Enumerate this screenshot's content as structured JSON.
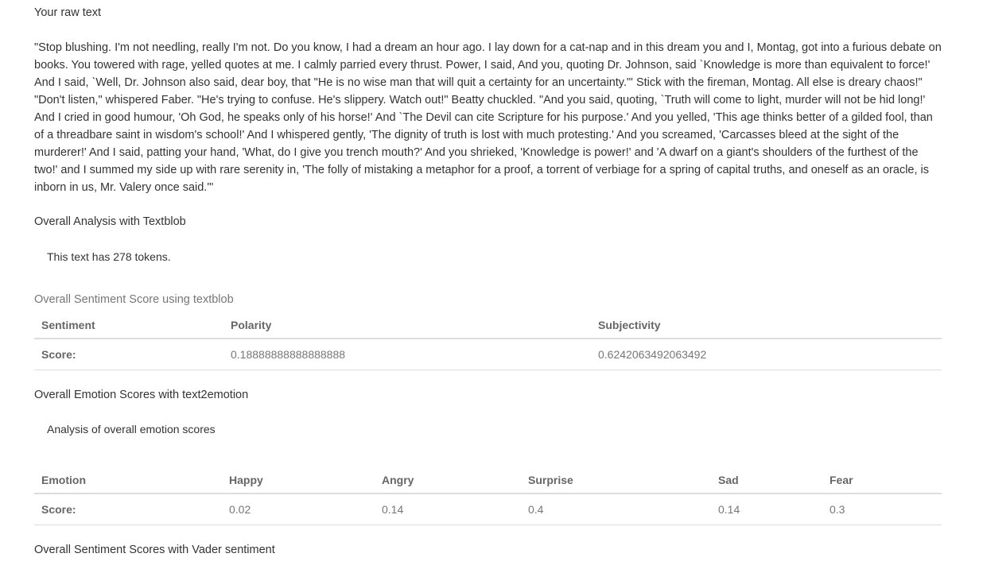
{
  "raw": {
    "title": "Your raw text",
    "text": "\"Stop blushing. I'm not needling, really I'm not. Do you know, I had a dream an hour ago. I lay down for a cat-nap and in this dream you and I, Montag, got into a furious debate on books. You towered with rage, yelled quotes at me. I calmly parried every thrust. Power, I said, And you, quoting Dr. Johnson, said `Knowledge is more than equivalent to force!' And I said, `Well, Dr. Johnson also said, dear boy, that \"He is no wise man that will quit a certainty for an uncertainty.\"' Stick with the fireman, Montag. All else is dreary chaos!\" \"Don't listen,\" whispered Faber. \"He's trying to confuse. He's slippery. Watch out!\" Beatty chuckled. \"And you said, quoting, `Truth will come to light, murder will not be hid long!' And I cried in good humour, 'Oh God, he speaks only of his horse!' And `The Devil can cite Scripture for his purpose.' And you yelled, 'This age thinks better of a gilded fool, than of a threadbare saint in wisdom's school!' And I whispered gently, 'The dignity of truth is lost with much protesting.' And you screamed, 'Carcasses bleed at the sight of the murderer!' And I said, patting your hand, 'What, do I give you trench mouth?' And you shrieked, 'Knowledge is power!' and 'A dwarf on a giant's shoulders of the furthest of the two!' and I summed my side up with rare serenity in, 'The folly of mistaking a metaphor for a proof, a torrent of verbiage for a spring of capital truths, and oneself as an oracle, is inborn in us, Mr. Valery once said.'\""
  },
  "analysis": {
    "title": "Overall Analysis with Textblob",
    "tokens": "This text has 278 tokens."
  },
  "sentiment": {
    "title": "Overall Sentiment Score using textblob",
    "headers": [
      "Sentiment",
      "Polarity",
      "Subjectivity"
    ],
    "row": [
      "Score:",
      "0.18888888888888888",
      "0.6242063492063492"
    ]
  },
  "emotion": {
    "title": "Overall Emotion Scores with text2emotion",
    "subtitle": "Analysis of overall emotion scores",
    "headers": [
      "Emotion",
      "Happy",
      "Angry",
      "Surprise",
      "Sad",
      "Fear"
    ],
    "row": [
      "Score:",
      "0.02",
      "0.14",
      "0.4",
      "0.14",
      "0.3"
    ]
  },
  "vader": {
    "title": "Overall Sentiment Scores with Vader sentiment"
  }
}
